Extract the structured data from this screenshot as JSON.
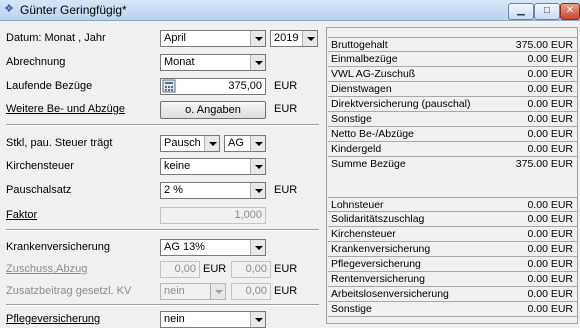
{
  "window": {
    "title": "Günter Geringfügig*",
    "minimize": "▁",
    "maximize": "□",
    "close": "✕"
  },
  "form": {
    "datum_label": "Datum: Monat , Jahr",
    "month_value": "April",
    "year_value": "2019",
    "abrechnung_label": "Abrechnung",
    "abrechnung_value": "Monat",
    "laufende_label": "Laufende Bezüge",
    "laufende_value": "375,00",
    "eur": "EUR",
    "weitere_label": "Weitere Be- und Abzüge",
    "weitere_button": "o. Angaben",
    "stkl_label": "Stkl, pau. Steuer trägt",
    "stkl_value": "Pausch",
    "ag_value": "AG",
    "kirchensteuer_label": "Kirchensteuer",
    "kirchensteuer_value": "keine",
    "pauschalsatz_label": "Pauschalsatz",
    "pauschalsatz_value": "2 %",
    "faktor_label": "Faktor",
    "faktor_value": "1,000",
    "kv_label": "Krankenversicherung",
    "kv_value": "AG 13%",
    "zuschuss_label": "Zuschuss,Abzug",
    "zuschuss_value1": "0,00",
    "zuschuss_value2": "0,00",
    "zusatz_label": "Zusatzbeitrag gesetzl. KV",
    "zusatz_select": "nein",
    "zusatz_value": "0,00",
    "pflege_label": "Pflegeversicherung",
    "pflege_value": "nein"
  },
  "summary": {
    "top": [
      {
        "label": "Bruttogehalt",
        "value": "375.00 EUR"
      },
      {
        "label": "Einmalbezüge",
        "value": "0.00 EUR"
      },
      {
        "label": "VWL AG-Zuschuß",
        "value": "0.00 EUR"
      },
      {
        "label": "Dienstwagen",
        "value": "0.00 EUR"
      },
      {
        "label": "Direktversicherung (pauschal)",
        "value": "0.00 EUR"
      },
      {
        "label": "Sonstige",
        "value": "0.00 EUR"
      },
      {
        "label": "Netto Be-/Abzüge",
        "value": "0.00 EUR"
      },
      {
        "label": "Kindergeld",
        "value": "0.00 EUR"
      },
      {
        "label": "Summe Bezüge",
        "value": "375.00 EUR"
      }
    ],
    "bottom": [
      {
        "label": "Lohnsteuer",
        "value": "0.00 EUR"
      },
      {
        "label": "Solidaritätszuschlag",
        "value": "0.00 EUR"
      },
      {
        "label": "Kirchensteuer",
        "value": "0.00 EUR"
      },
      {
        "label": "Krankenversicherung",
        "value": "0.00 EUR"
      },
      {
        "label": "Pflegeversicherung",
        "value": "0.00 EUR"
      },
      {
        "label": "Rentenversicherung",
        "value": "0.00 EUR"
      },
      {
        "label": "Arbeitslosenversicherung",
        "value": "0.00 EUR"
      },
      {
        "label": "Sonstige",
        "value": "0.00 EUR"
      }
    ]
  }
}
